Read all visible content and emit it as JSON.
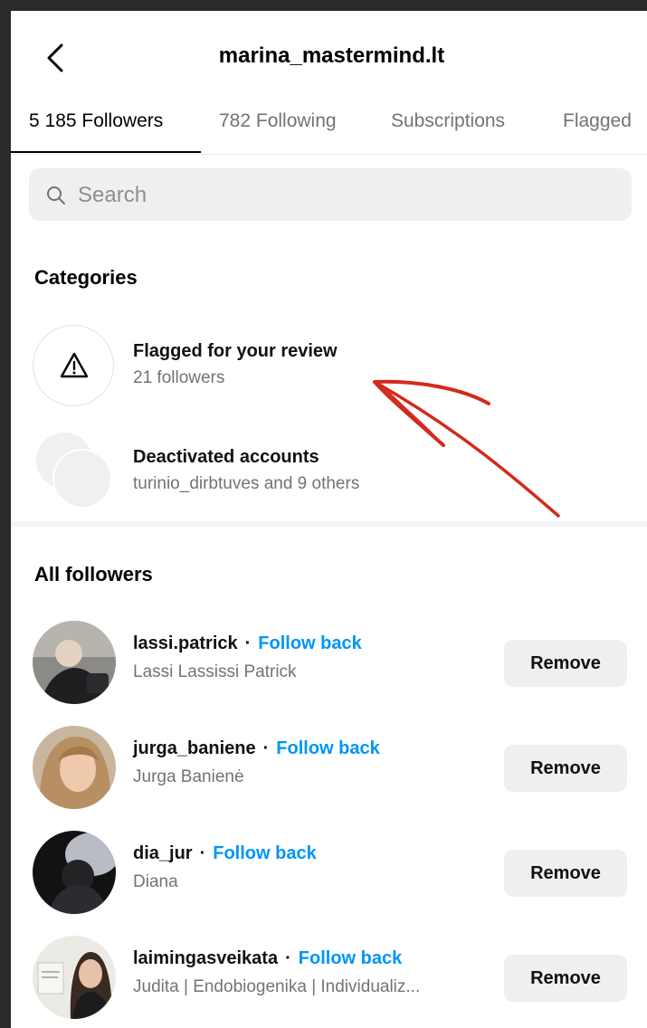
{
  "header": {
    "title": "marina_mastermind.lt",
    "back_icon": "chevron-left-icon"
  },
  "tabs": [
    {
      "label": "5 185 Followers",
      "active": true
    },
    {
      "label": "782 Following",
      "active": false
    },
    {
      "label": "Subscriptions",
      "active": false
    },
    {
      "label": "Flagged",
      "active": false
    }
  ],
  "search": {
    "placeholder": "Search",
    "value": "",
    "icon": "search-icon"
  },
  "categories": {
    "title": "Categories",
    "items": [
      {
        "title": "Flagged for your review",
        "subtitle": "21 followers",
        "icon": "warning-icon"
      },
      {
        "title": "Deactivated accounts",
        "subtitle": "turinio_dirbtuves and 9 others",
        "icon": "stacked-avatars-icon"
      }
    ]
  },
  "all_followers": {
    "title": "All followers",
    "items": [
      {
        "username": "lassi.patrick",
        "separator": "·",
        "action": "Follow back",
        "name": "Lassi Lassissi Patrick",
        "button": "Remove"
      },
      {
        "username": "jurga_baniene",
        "separator": "·",
        "action": "Follow back",
        "name": "Jurga Banienė",
        "button": "Remove"
      },
      {
        "username": "dia_jur",
        "separator": "·",
        "action": "Follow back",
        "name": "Diana",
        "button": "Remove"
      },
      {
        "username": "laimingasveikata",
        "separator": "·",
        "action": "Follow back",
        "name": "Judita | Endobiogenika | Individualiz...",
        "button": "Remove"
      }
    ]
  },
  "colors": {
    "link": "#0095f6",
    "muted": "#737373",
    "annotation_arrow": "#d42a1c",
    "search_bg": "#efefef"
  }
}
